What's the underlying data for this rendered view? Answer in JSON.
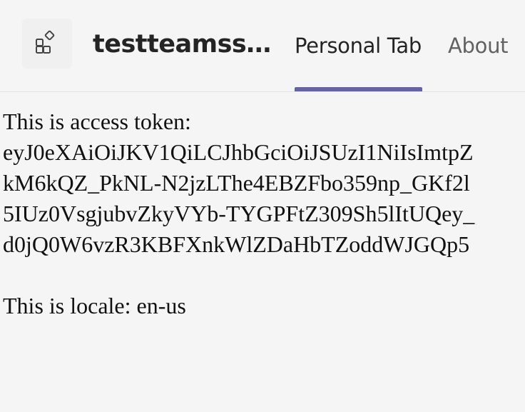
{
  "header": {
    "app_icon": "app-grid-icon",
    "app_title": "testteamss…",
    "accent_color": "#6264a7"
  },
  "tabs": [
    {
      "label": "Personal Tab",
      "active": true
    },
    {
      "label": "About",
      "active": false
    }
  ],
  "content": {
    "token_label": "This is access token:",
    "token_lines": [
      "eyJ0eXAiOiJKV1QiLCJhbGciOiJSUzI1NiIsImtpZ",
      "kM6kQZ_PkNL-N2jzLThe4EBZFbo359np_GKf2l",
      "5IUz0VsgjubvZkyVYb-TYGPFtZ309Sh5lItUQey_",
      "d0jQ0W6vzR3KBFXnkWlZDaHbTZoddWJGQp5"
    ],
    "locale_text": "This is locale: en-us"
  }
}
